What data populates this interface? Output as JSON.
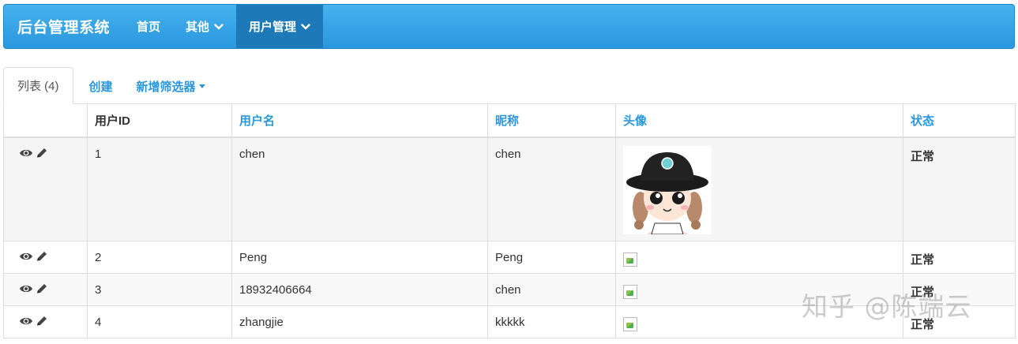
{
  "navbar": {
    "brand": "后台管理系统",
    "items": [
      {
        "label": "首页"
      },
      {
        "label": "其他"
      },
      {
        "label": "用户管理"
      }
    ]
  },
  "tabs": {
    "list": "列表 (4)",
    "create": "创建",
    "filter": "新增筛选器"
  },
  "table": {
    "headers": [
      "用户ID",
      "用户名",
      "昵称",
      "头像",
      "状态"
    ],
    "rows": [
      {
        "id": "1",
        "username": "chen",
        "nickname": "chen",
        "status": "正常"
      },
      {
        "id": "2",
        "username": "Peng",
        "nickname": "Peng",
        "status": "正常"
      },
      {
        "id": "3",
        "username": "18932406664",
        "nickname": "chen",
        "status": "正常"
      },
      {
        "id": "4",
        "username": "zhangjie",
        "nickname": "kkkkk",
        "status": "正常"
      }
    ]
  },
  "watermark": "知乎 @陈端云",
  "colors": {
    "accent": "#2a97df",
    "navbar_active": "#1d79b7"
  },
  "icons": {
    "view": "eye-icon",
    "edit": "pencil-icon",
    "dropdown": "chevron-down-icon",
    "broken_image": "broken-image-icon"
  }
}
